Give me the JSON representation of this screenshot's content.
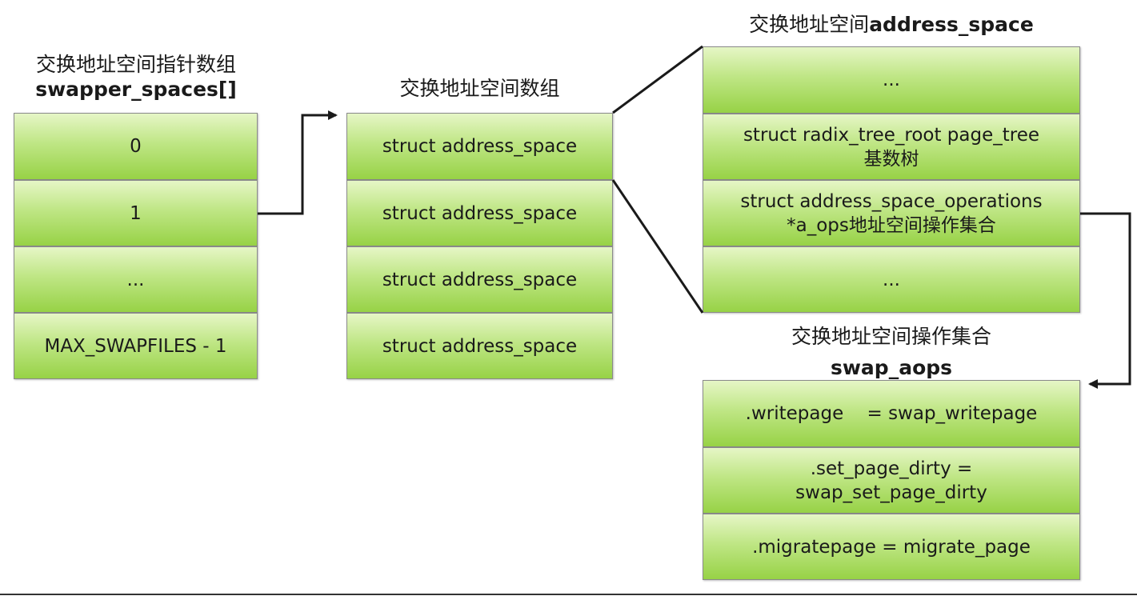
{
  "pointer_array": {
    "title_cn": "交换地址空间指针数组",
    "title_en": "swapper_spaces[]",
    "cells": [
      "0",
      "1",
      "...",
      "MAX_SWAPFILES - 1"
    ]
  },
  "space_array": {
    "title_cn": "交换地址空间数组",
    "cells": [
      "struct address_space",
      "struct address_space",
      "struct address_space",
      "struct address_space"
    ]
  },
  "address_space": {
    "title_cn": "交换地址空间",
    "title_en": "address_space",
    "cells": [
      [
        "..."
      ],
      [
        "struct radix_tree_root page_tree",
        "基数树"
      ],
      [
        "struct address_space_operations",
        "*a_ops地址空间操作集合"
      ],
      [
        "..."
      ]
    ]
  },
  "swap_aops": {
    "title_cn": "交换地址空间操作集合",
    "title_en": "swap_aops",
    "cells": [
      [
        ".writepage    = swap_writepage"
      ],
      [
        ".set_page_dirty =",
        "swap_set_page_dirty"
      ],
      [
        ".migratepage = migrate_page"
      ]
    ]
  },
  "colors": {
    "cell_top": "#e6f6c6",
    "cell_bottom": "#97d246",
    "border": "#8a8a8a",
    "connector": "#1a1a1a"
  }
}
